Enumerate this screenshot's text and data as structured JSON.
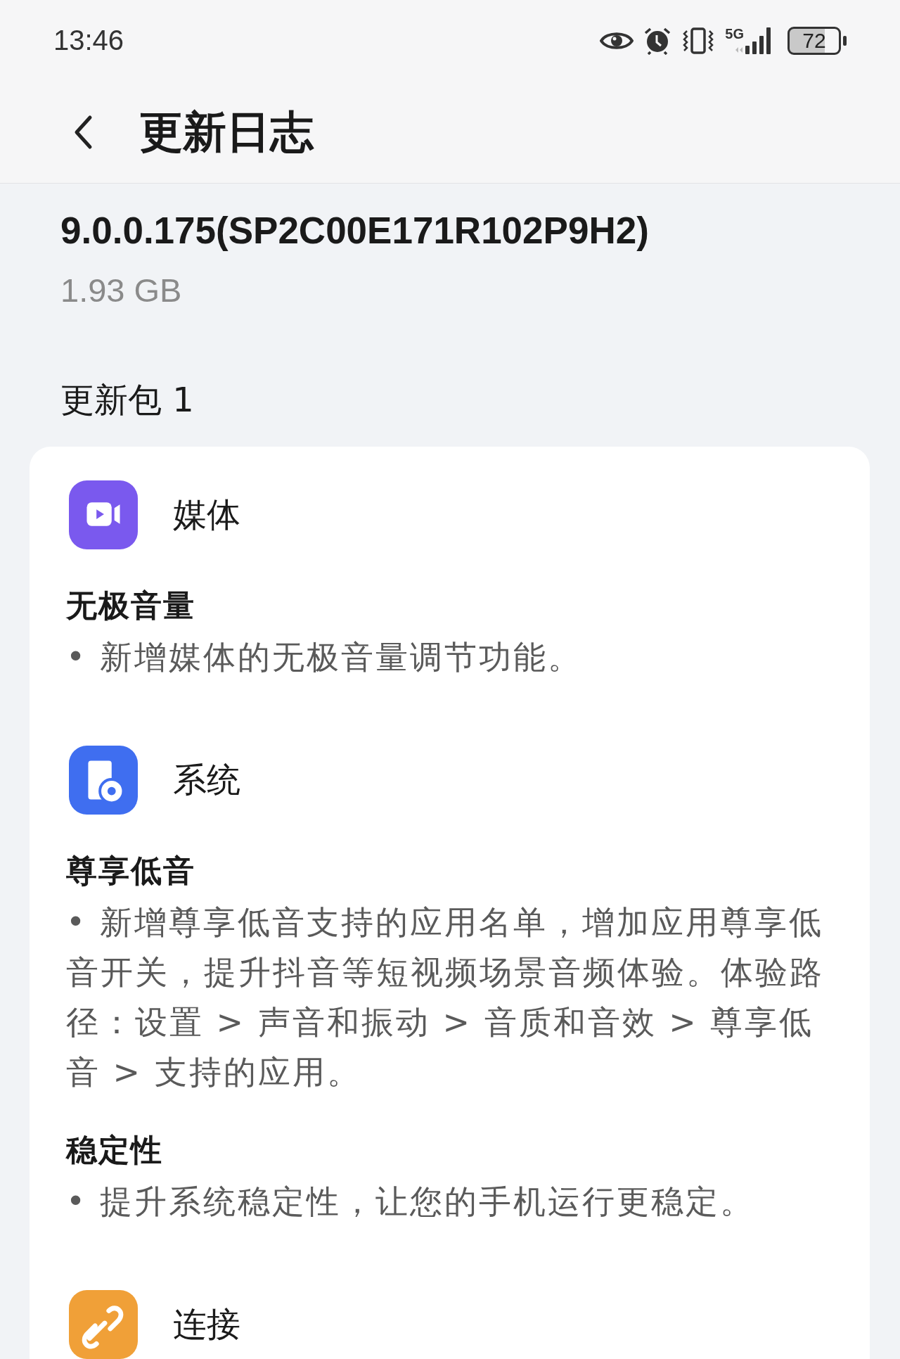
{
  "status_bar": {
    "time": "13:46",
    "network": "5G",
    "battery": "72"
  },
  "header": {
    "title": "更新日志"
  },
  "version": {
    "name": "9.0.0.175(SP2C00E171R102P9H2)",
    "size": "1.93 GB"
  },
  "package_title": "更新包 1",
  "sections": [
    {
      "kind": "media",
      "title": "媒体",
      "features": [
        {
          "title": "无极音量",
          "text": "• 新增媒体的无极音量调节功能。"
        }
      ]
    },
    {
      "kind": "system",
      "title": "系统",
      "features": [
        {
          "title": "尊享低音",
          "text": "• 新增尊享低音支持的应用名单，增加应用尊享低音开关，提升抖音等短视频场景音频体验。体验路径：设置 > 声音和振动 > 音质和音效 > 尊享低音 > 支持的应用。"
        },
        {
          "title": "稳定性",
          "text": "• 提升系统稳定性，让您的手机运行更稳定。"
        }
      ]
    },
    {
      "kind": "connect",
      "title": "连接"
    }
  ]
}
